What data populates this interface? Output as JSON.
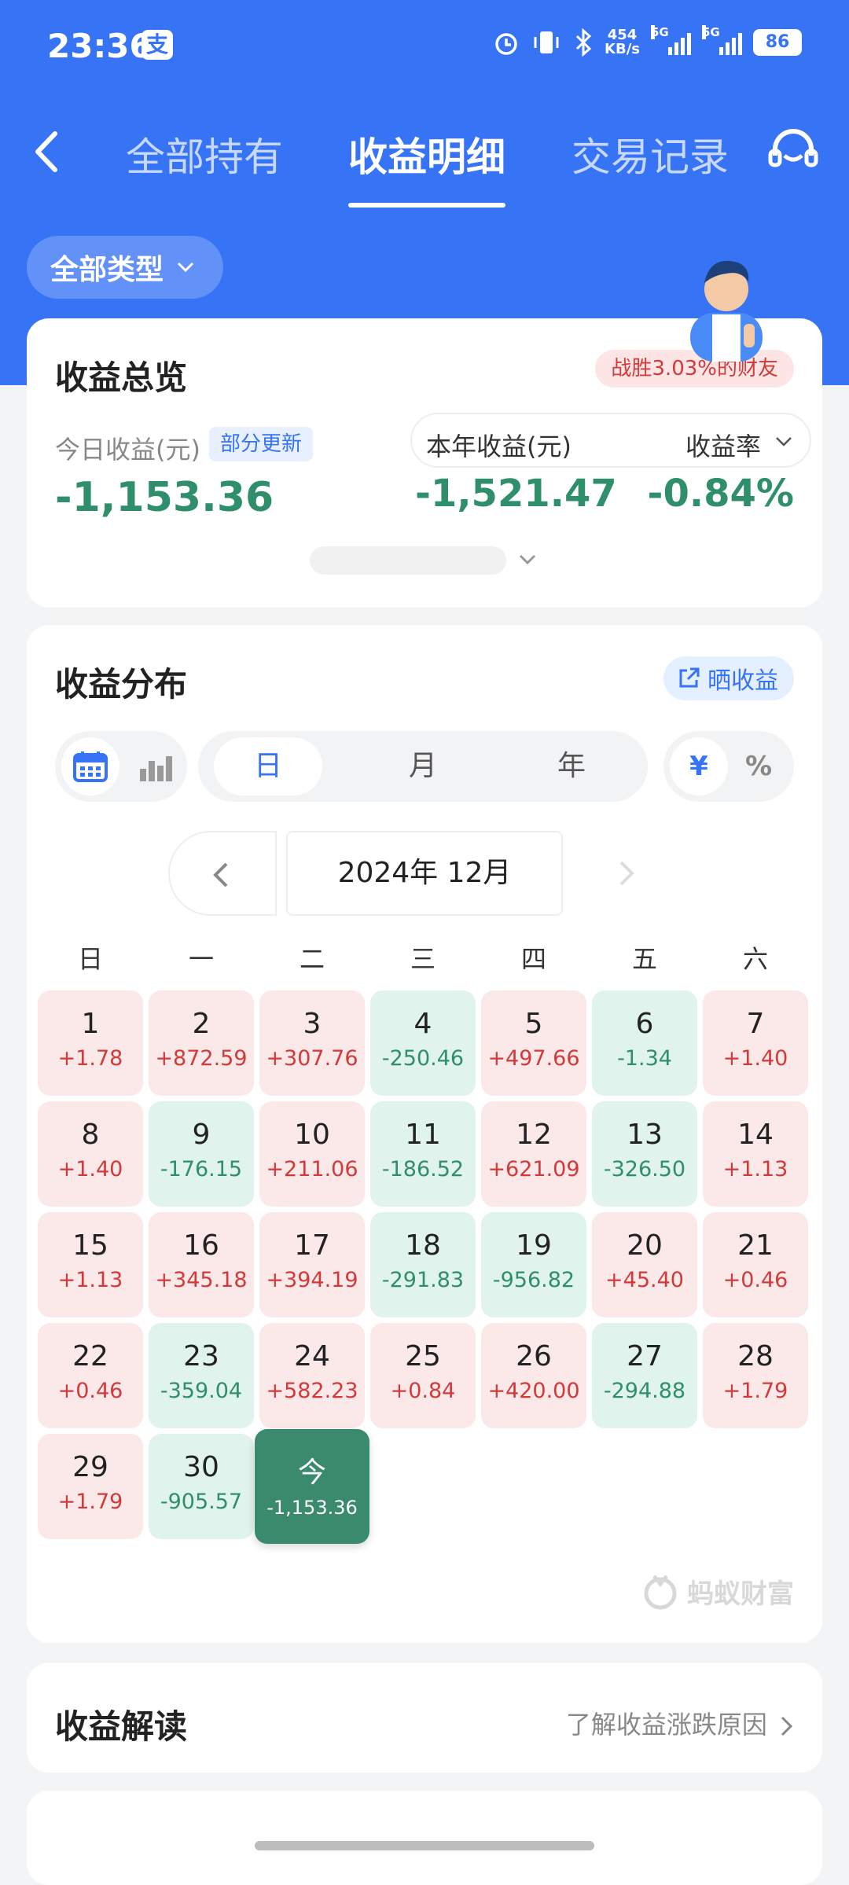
{
  "status_bar": {
    "time": "23:36",
    "app_icon_glyph": "支",
    "network_speed_top": "454",
    "network_speed_bottom": "KB/s",
    "signal_label_1": "5G",
    "signal_label_2": "5G",
    "battery": "86"
  },
  "nav": {
    "tabs": [
      "全部持有",
      "收益明细",
      "交易记录"
    ],
    "active_tab": 1
  },
  "filter": {
    "label": "全部类型"
  },
  "overview": {
    "title": "收益总览",
    "badge": "战胜3.03%的财友",
    "today_label": "今日收益(元)",
    "partial_update": "部分更新",
    "today_value": "-1,153.36",
    "year_label": "本年收益(元)",
    "rate_label": "收益率",
    "year_value": "-1,521.47",
    "rate_value": "-0.84%"
  },
  "distribution": {
    "title": "收益分布",
    "share_label": "晒收益",
    "periods": [
      "日",
      "月",
      "年"
    ],
    "active_period": 0,
    "units": [
      "¥",
      "%"
    ],
    "active_unit": 0,
    "month_label": "2024年 12月",
    "weekdays": [
      "日",
      "一",
      "二",
      "三",
      "四",
      "五",
      "六"
    ],
    "days": [
      {
        "day": "1",
        "value": "+1.78",
        "sign": "pos"
      },
      {
        "day": "2",
        "value": "+872.59",
        "sign": "pos"
      },
      {
        "day": "3",
        "value": "+307.76",
        "sign": "pos"
      },
      {
        "day": "4",
        "value": "-250.46",
        "sign": "neg"
      },
      {
        "day": "5",
        "value": "+497.66",
        "sign": "pos"
      },
      {
        "day": "6",
        "value": "-1.34",
        "sign": "neg"
      },
      {
        "day": "7",
        "value": "+1.40",
        "sign": "pos"
      },
      {
        "day": "8",
        "value": "+1.40",
        "sign": "pos"
      },
      {
        "day": "9",
        "value": "-176.15",
        "sign": "neg"
      },
      {
        "day": "10",
        "value": "+211.06",
        "sign": "pos"
      },
      {
        "day": "11",
        "value": "-186.52",
        "sign": "neg"
      },
      {
        "day": "12",
        "value": "+621.09",
        "sign": "pos"
      },
      {
        "day": "13",
        "value": "-326.50",
        "sign": "neg"
      },
      {
        "day": "14",
        "value": "+1.13",
        "sign": "pos"
      },
      {
        "day": "15",
        "value": "+1.13",
        "sign": "pos"
      },
      {
        "day": "16",
        "value": "+345.18",
        "sign": "pos"
      },
      {
        "day": "17",
        "value": "+394.19",
        "sign": "pos"
      },
      {
        "day": "18",
        "value": "-291.83",
        "sign": "neg"
      },
      {
        "day": "19",
        "value": "-956.82",
        "sign": "neg"
      },
      {
        "day": "20",
        "value": "+45.40",
        "sign": "pos"
      },
      {
        "day": "21",
        "value": "+0.46",
        "sign": "pos"
      },
      {
        "day": "22",
        "value": "+0.46",
        "sign": "pos"
      },
      {
        "day": "23",
        "value": "-359.04",
        "sign": "neg"
      },
      {
        "day": "24",
        "value": "+582.23",
        "sign": "pos"
      },
      {
        "day": "25",
        "value": "+0.84",
        "sign": "pos"
      },
      {
        "day": "26",
        "value": "+420.00",
        "sign": "pos"
      },
      {
        "day": "27",
        "value": "-294.88",
        "sign": "neg"
      },
      {
        "day": "28",
        "value": "+1.79",
        "sign": "pos"
      },
      {
        "day": "29",
        "value": "+1.79",
        "sign": "pos"
      },
      {
        "day": "30",
        "value": "-905.57",
        "sign": "neg"
      },
      {
        "day": "今",
        "value": "-1,153.36",
        "sign": "today"
      }
    ],
    "watermark": "蚂蚁财富"
  },
  "interpret": {
    "title": "收益解读",
    "link": "了解收益涨跌原因"
  },
  "colors": {
    "brand_blue": "#3673f5",
    "gain_red": "#d23a3a",
    "loss_green": "#2f8f6b",
    "today_green": "#3a8a6e"
  }
}
